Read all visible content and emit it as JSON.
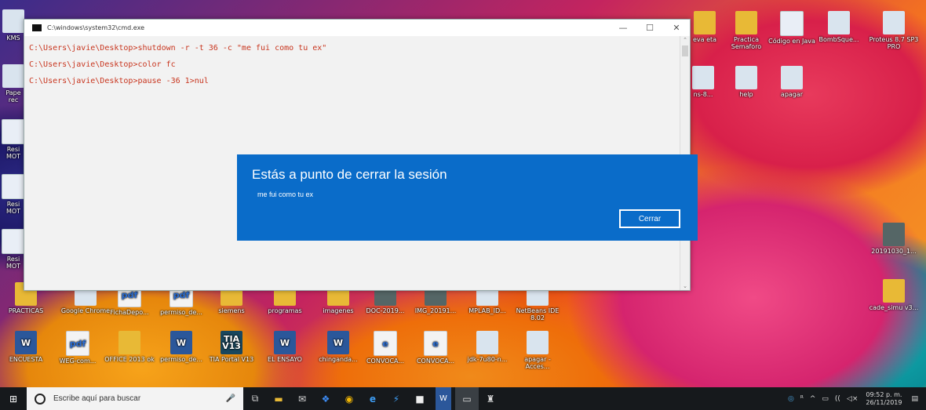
{
  "cmd_window": {
    "title": "C:\\windows\\system32\\cmd.exe",
    "lines": [
      "C:\\Users\\javie\\Desktop>shutdown -r -t 36 -c \"me fui como tu ex\"",
      "C:\\Users\\javie\\Desktop>color fc",
      "C:\\Users\\javie\\Desktop>pause -36  1>nul"
    ],
    "minimize": "—",
    "maximize": "☐",
    "close": "✕"
  },
  "dialog": {
    "title": "Estás a punto de cerrar la sesión",
    "message": "me fui como tu ex",
    "button": "Cerrar"
  },
  "desktop_icons": {
    "left_col": [
      "KMS",
      "Pape rec",
      "Resi MOT",
      "Resi MOT",
      "Resi MOT"
    ],
    "top_right": [
      "eva eta",
      "Practica Semaforo",
      "Código en Java",
      "BombSque...",
      "Proteus 8.7 SP3 PRO"
    ],
    "row2_right": [
      "ns-8...",
      "help",
      "apagar"
    ],
    "right_col": [
      "20191030_1...",
      "cade_simu v3..."
    ],
    "row_a": [
      "PRACTICAS",
      "Google Chrome",
      "FichaDepo...",
      "permiso_de...",
      "siemens",
      "programas",
      "imagenes",
      "DOC-2019...",
      "IMG_20191...",
      "MPLAB_ID...",
      "NetBeans IDE 8.02"
    ],
    "row_b": [
      "ENCUESTA",
      "WEG-com...",
      "OFFICE 2013 ok",
      "permiso_de...",
      "TIA Portal V13",
      "EL ENSAYO",
      "chinganda...",
      "CONVOCA...",
      "CONVOCA...",
      "jdk-7u80-n...",
      "apagar - Acces..."
    ],
    "pdf_label": "pdf",
    "tia_label": "TIA V13",
    "e_label": "e"
  },
  "taskbar": {
    "start": "⊞",
    "search_placeholder": "Escribe aquí para buscar",
    "mic": "🎤",
    "time": "09:52 p. m.",
    "date": "26/11/2019",
    "apps": [
      "⧉",
      "▬",
      "✉",
      "❖",
      "◉",
      "e",
      "⚡",
      "■",
      "W",
      "▭",
      "♜"
    ],
    "tray_icons": [
      "◎",
      "ᴿ",
      "^",
      "▭",
      "((",
      "◁×",
      "▤"
    ]
  },
  "colors": {
    "dialog_bg": "#0a6cc9",
    "console_text": "#c8351e",
    "console_bg": "#f2f2f2",
    "taskbar_bg": "#16191c"
  }
}
